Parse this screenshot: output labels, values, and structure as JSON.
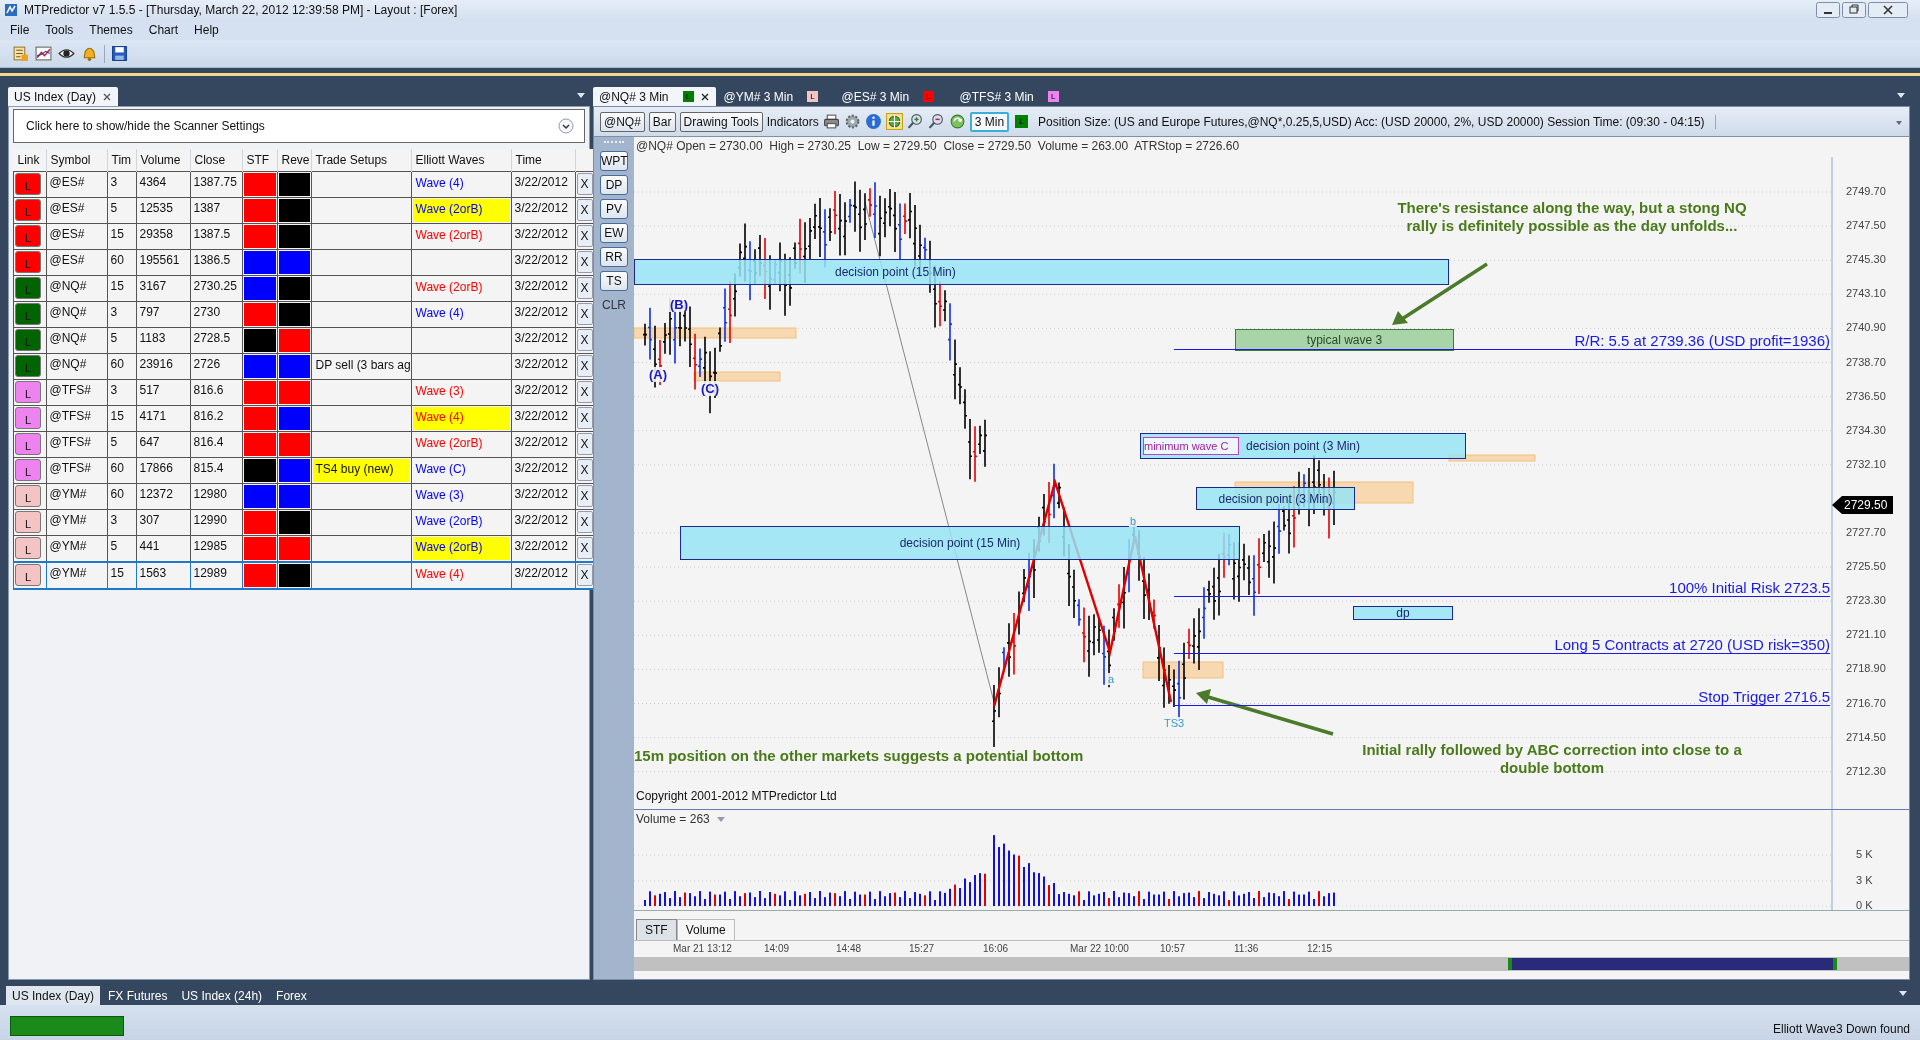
{
  "window": {
    "title": "MTPredictor v7 1.5.5 - [Thursday, March 22, 2012 12:39:58 PM]  - Layout : [Forex]"
  },
  "menu": [
    "File",
    "Tools",
    "Themes",
    "Chart",
    "Help"
  ],
  "scanner": {
    "tab": "US Index (Day)",
    "settings_toggle": "Click here to show/hide the Scanner Settings",
    "columns": [
      "Link",
      "Symbol",
      "Tim",
      "Volume",
      "Close",
      "STF",
      "Reve",
      "Trade Setups",
      "Elliott Waves",
      "Time"
    ],
    "rows": [
      {
        "link": {
          "text": "L",
          "color": "#ff0000"
        },
        "symbol": "@ES#",
        "interval": "3",
        "volume": "4364",
        "close": "1387.75",
        "stf": {
          "color": "#ff0000"
        },
        "rev": {
          "color": "#000000"
        },
        "wave": {
          "text": "Wave (4)",
          "color": "#0000ff",
          "highlight": false
        },
        "time": "3/22/2012",
        "remove": "X",
        "selected": false
      },
      {
        "link": {
          "text": "L",
          "color": "#ff0000"
        },
        "symbol": "@ES#",
        "interval": "5",
        "volume": "12535",
        "close": "1387",
        "stf": {
          "color": "#ff0000"
        },
        "rev": {
          "color": "#000000"
        },
        "wave": {
          "text": "Wave (2orB)",
          "color": "#0000ff",
          "highlight": true
        },
        "time": "3/22/2012",
        "remove": "X",
        "selected": false
      },
      {
        "link": {
          "text": "L",
          "color": "#ff0000"
        },
        "symbol": "@ES#",
        "interval": "15",
        "volume": "29358",
        "close": "1387.5",
        "stf": {
          "color": "#ff0000"
        },
        "rev": {
          "color": "#000000"
        },
        "wave": {
          "text": "Wave (2orB)",
          "color": "#ff0000",
          "highlight": false
        },
        "time": "3/22/2012",
        "remove": "X",
        "selected": false
      },
      {
        "link": {
          "text": "L",
          "color": "#ff0000"
        },
        "symbol": "@ES#",
        "interval": "60",
        "volume": "195561",
        "close": "1386.5",
        "stf": {
          "color": "#0000ff"
        },
        "rev": {
          "color": "#0000ff"
        },
        "time": "3/22/2012",
        "remove": "X",
        "selected": false
      },
      {
        "link": {
          "text": "L",
          "color": "#006400"
        },
        "symbol": "@NQ#",
        "interval": "15",
        "volume": "3167",
        "close": "2730.25",
        "stf": {
          "color": "#0000ff"
        },
        "rev": {
          "color": "#000000"
        },
        "wave": {
          "text": "Wave (2orB)",
          "color": "#ff0000",
          "highlight": false
        },
        "time": "3/22/2012",
        "remove": "X",
        "selected": false
      },
      {
        "link": {
          "text": "L",
          "color": "#006400"
        },
        "symbol": "@NQ#",
        "interval": "3",
        "volume": "797",
        "close": "2730",
        "stf": {
          "color": "#ff0000"
        },
        "rev": {
          "color": "#000000"
        },
        "wave": {
          "text": "Wave (4)",
          "color": "#0000ff",
          "highlight": false
        },
        "time": "3/22/2012",
        "remove": "X",
        "selected": false
      },
      {
        "link": {
          "text": "L",
          "color": "#006400"
        },
        "symbol": "@NQ#",
        "interval": "5",
        "volume": "1183",
        "close": "2728.5",
        "stf": {
          "color": "#000000"
        },
        "rev": {
          "color": "#ff0000"
        },
        "time": "3/22/2012",
        "remove": "X",
        "selected": false
      },
      {
        "link": {
          "text": "L",
          "color": "#006400"
        },
        "symbol": "@NQ#",
        "interval": "60",
        "volume": "23916",
        "close": "2726",
        "stf": {
          "color": "#0000ff"
        },
        "rev": {
          "color": "#0000ff"
        },
        "setup": {
          "text": "DP sell (3 bars ag",
          "highlight": false
        },
        "time": "3/22/2012",
        "remove": "X",
        "selected": false
      },
      {
        "link": {
          "text": "L",
          "color": "#ee82ee"
        },
        "symbol": "@TFS#",
        "interval": "3",
        "volume": "517",
        "close": "816.6",
        "stf": {
          "color": "#ff0000"
        },
        "rev": {
          "color": "#ff0000"
        },
        "wave": {
          "text": "Wave (3)",
          "color": "#ff0000",
          "highlight": false
        },
        "time": "3/22/2012",
        "remove": "X",
        "selected": false
      },
      {
        "link": {
          "text": "L",
          "color": "#ee82ee"
        },
        "symbol": "@TFS#",
        "interval": "15",
        "volume": "4171",
        "close": "816.2",
        "stf": {
          "color": "#ff0000"
        },
        "rev": {
          "color": "#0000ff"
        },
        "wave": {
          "text": "Wave (4)",
          "color": "#ff0000",
          "highlight": true
        },
        "time": "3/22/2012",
        "remove": "X",
        "selected": false
      },
      {
        "link": {
          "text": "L",
          "color": "#ee82ee"
        },
        "symbol": "@TFS#",
        "interval": "5",
        "volume": "647",
        "close": "816.4",
        "stf": {
          "color": "#ff0000"
        },
        "rev": {
          "color": "#ff0000"
        },
        "wave": {
          "text": "Wave (2orB)",
          "color": "#ff0000",
          "highlight": false
        },
        "time": "3/22/2012",
        "remove": "X",
        "selected": false
      },
      {
        "link": {
          "text": "L",
          "color": "#ee82ee"
        },
        "symbol": "@TFS#",
        "interval": "60",
        "volume": "17866",
        "close": "815.4",
        "stf": {
          "color": "#000000"
        },
        "rev": {
          "color": "#0000ff"
        },
        "setup": {
          "text": "TS4 buy (new)",
          "highlight": true
        },
        "wave": {
          "text": "Wave (C)",
          "color": "#0000ff",
          "highlight": false
        },
        "time": "3/22/2012",
        "remove": "X",
        "selected": false
      },
      {
        "link": {
          "text": "L",
          "color": "#f4c4c4"
        },
        "symbol": "@YM#",
        "interval": "60",
        "volume": "12372",
        "close": "12980",
        "stf": {
          "color": "#0000ff"
        },
        "rev": {
          "color": "#0000ff"
        },
        "wave": {
          "text": "Wave (3)",
          "color": "#0000ff",
          "highlight": false
        },
        "time": "3/22/2012",
        "remove": "X",
        "selected": false
      },
      {
        "link": {
          "text": "L",
          "color": "#f4c4c4"
        },
        "symbol": "@YM#",
        "interval": "3",
        "volume": "307",
        "close": "12990",
        "stf": {
          "color": "#ff0000"
        },
        "rev": {
          "color": "#000000"
        },
        "wave": {
          "text": "Wave (2orB)",
          "color": "#0000ff",
          "highlight": false
        },
        "time": "3/22/2012",
        "remove": "X",
        "selected": false
      },
      {
        "link": {
          "text": "L",
          "color": "#f4c4c4"
        },
        "symbol": "@YM#",
        "interval": "5",
        "volume": "441",
        "close": "12985",
        "stf": {
          "color": "#ff0000"
        },
        "rev": {
          "color": "#ff0000"
        },
        "wave": {
          "text": "Wave (2orB)",
          "color": "#0000ff",
          "highlight": true
        },
        "time": "3/22/2012",
        "remove": "X",
        "selected": false
      },
      {
        "link": {
          "text": "L",
          "color": "#f4c4c4"
        },
        "symbol": "@YM#",
        "interval": "15",
        "volume": "1563",
        "close": "12989",
        "stf": {
          "color": "#ff0000"
        },
        "rev": {
          "color": "#000000"
        },
        "wave": {
          "text": "Wave (4)",
          "color": "#ff0000",
          "highlight": false
        },
        "time": "3/22/2012",
        "remove": "X",
        "selected": true
      }
    ]
  },
  "chart_tabs": [
    {
      "label": "@NQ# 3 Min",
      "link": "L",
      "color": "#008000",
      "selected": true
    },
    {
      "label": "@YM# 3 Min",
      "link": "L",
      "color": "#f4c4c4",
      "selected": false
    },
    {
      "label": "@ES# 3 Min",
      "link": "L",
      "color": "#ff0000",
      "selected": false
    },
    {
      "label": "@TFS# 3 Min",
      "link": "L",
      "color": "#ee82ee",
      "selected": false
    }
  ],
  "chart_toolbar": {
    "symbol": "@NQ#",
    "bar": "Bar",
    "drawing_tools": "Drawing Tools",
    "indicators": "Indicators",
    "interval": "3 Min",
    "link": {
      "text": "L",
      "color": "#008000"
    },
    "position": "Position Size: (US and Europe Futures,@NQ*,0.25,5,USD) Acc: (USD 20000, 2%, USD 20000) Session Time: (09:30 - 04:15)"
  },
  "chart": {
    "info": "@NQ# Open = 2730.00  High = 2730.25  Low = 2729.50  Close = 2729.50  Volume = 263.00  ATRStop = 2726.60",
    "side_tools": [
      "WPT",
      "DP",
      "PV",
      "EW",
      "RR",
      "TS",
      "CLR"
    ],
    "price_ticks": [
      "2749.70",
      "2747.50",
      "2745.30",
      "2743.10",
      "2740.90",
      "2738.70",
      "2736.50",
      "2734.30",
      "2732.10",
      "2727.70",
      "2725.50",
      "2723.30",
      "2721.10",
      "2718.90",
      "2716.70",
      "2714.50",
      "2712.30"
    ],
    "last_price": "2729.50",
    "zones": [
      {
        "label": "decision point (15 Min)",
        "kind": "decision"
      },
      {
        "label": "typical wave 3",
        "kind": "target"
      },
      {
        "label": "minimum wave C",
        "kind": "outline"
      },
      {
        "label": "decision point (3 Min)",
        "kind": "decision"
      },
      {
        "label": "decision point (3 Min)",
        "kind": "decision"
      },
      {
        "label": "decision point (15 Min)",
        "kind": "decision"
      },
      {
        "label": "dp",
        "kind": "decision"
      }
    ],
    "levels": [
      "R/R: 5.5 at 2739.36 (USD profit=1936)",
      "100% Initial Risk 2723.5",
      "Long 5 Contracts at 2720 (USD risk=350)",
      "Stop Trigger 2716.5"
    ],
    "wave_labels": [
      {
        "text": "(A)",
        "kind": "major"
      },
      {
        "text": "(B)",
        "kind": "major"
      },
      {
        "text": "(C)",
        "kind": "major"
      },
      {
        "text": "a",
        "kind": "minor"
      },
      {
        "text": "b",
        "kind": "minor"
      },
      {
        "text": "TS3",
        "kind": "minor"
      }
    ],
    "notes": [
      "There's resistance along the way, but a stong NQ rally is definitely possible as the day unfolds...",
      "15m position on the other markets suggests a potential bottom",
      "Initial rally followed by ABC correction into close to a double bottom"
    ],
    "copyright": "Copyright 2001-2012 MTPredictor Ltd"
  },
  "volume": {
    "label": "Volume = 263",
    "ticks": [
      "5 K",
      "3 K",
      "0 K"
    ]
  },
  "panel_tabs": [
    {
      "label": "STF",
      "selected": true
    },
    {
      "label": "Volume",
      "selected": false
    }
  ],
  "time_labels": [
    "Mar 21 13:12",
    "14:09",
    "14:48",
    "15:27",
    "16:06",
    "Mar 22 10:00",
    "10:57",
    "11:36",
    "12:15"
  ],
  "layout_tabs": [
    {
      "label": "US Index (Day)",
      "selected": true
    },
    {
      "label": "FX Futures",
      "selected": false
    },
    {
      "label": "US Index (24h)",
      "selected": false
    },
    {
      "label": "Forex",
      "selected": false
    }
  ],
  "status_bar": {
    "message": "Elliott Wave3 Down found"
  }
}
